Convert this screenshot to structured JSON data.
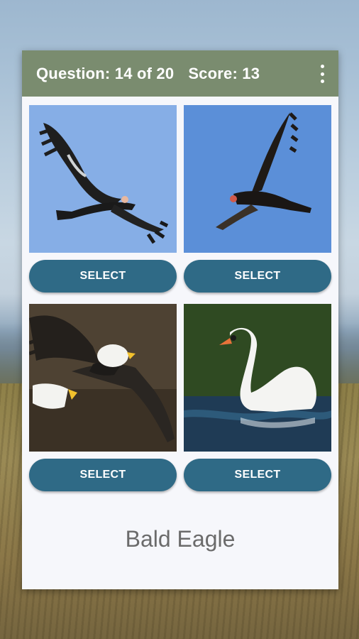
{
  "header": {
    "question": "Question: 14 of 20",
    "score": "Score: 13",
    "menu_icon": "more-vert-icon"
  },
  "options": [
    {
      "image": "condor-flying-photo",
      "button_label": "SELECT",
      "sky": "#86aee6"
    },
    {
      "image": "turkey-vulture-flying-photo",
      "button_label": "SELECT",
      "sky": "#5b8fd8"
    },
    {
      "image": "bald-eagle-flying-photo",
      "button_label": "SELECT",
      "sky": "#4e4233"
    },
    {
      "image": "mute-swan-swimming-photo",
      "button_label": "SELECT",
      "sky": "#2f4a22"
    }
  ],
  "prompt": {
    "answer_name": "Bald Eagle"
  },
  "colors": {
    "topbar": "#7a8c6f",
    "button": "#2f6a86",
    "card": "#f6f7fb",
    "prompt_text": "#6b6b6b"
  }
}
